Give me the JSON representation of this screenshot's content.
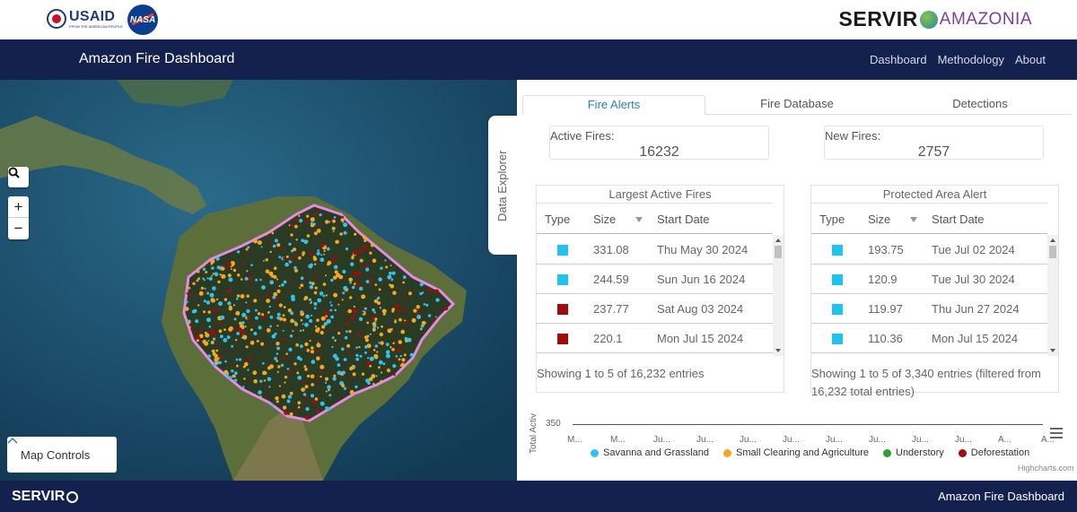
{
  "header": {
    "usaid_label": "USAID",
    "usaid_tagline": "FROM THE AMERICAN PEOPLE",
    "nasa_label": "NASA",
    "servir_label": "SERVIR",
    "amazonia_label": "AMAZONIA"
  },
  "navbar": {
    "title": "Amazon Fire Dashboard",
    "links": [
      "Dashboard",
      "Methodology",
      "About"
    ]
  },
  "map": {
    "search_icon": "search-icon",
    "zoom_in": "+",
    "zoom_out": "−",
    "map_controls_label": "Map Controls",
    "explorer_label": "Data Explorer"
  },
  "tabs": [
    "Fire Alerts",
    "Fire Database",
    "Detections"
  ],
  "active_tab": "Fire Alerts",
  "stats": {
    "active_fires_label": "Active Fires:",
    "active_fires_value": "16232",
    "new_fires_label": "New Fires:",
    "new_fires_value": "2757"
  },
  "largest_fires": {
    "title": "Largest Active Fires",
    "columns": [
      "Type",
      "Size",
      "Start Date"
    ],
    "rows": [
      {
        "color": "#1ec4f0",
        "size": "331.08",
        "date": "Thu May 30 2024"
      },
      {
        "color": "#1ec4f0",
        "size": "244.59",
        "date": "Sun Jun 16 2024"
      },
      {
        "color": "#a30b0b",
        "size": "237.77",
        "date": "Sat Aug 03 2024"
      },
      {
        "color": "#a30b0b",
        "size": "220.1",
        "date": "Mon Jul 15 2024"
      }
    ],
    "info": "Showing 1 to 5 of 16,232 entries"
  },
  "protected_alert": {
    "title": "Protected Area Alert",
    "columns": [
      "Type",
      "Size",
      "Start Date"
    ],
    "rows": [
      {
        "color": "#1ec4f0",
        "size": "193.75",
        "date": "Tue Jul 02 2024"
      },
      {
        "color": "#1ec4f0",
        "size": "120.9",
        "date": "Tue Jul 30 2024"
      },
      {
        "color": "#1ec4f0",
        "size": "119.97",
        "date": "Thu Jun 27 2024"
      },
      {
        "color": "#1ec4f0",
        "size": "110.36",
        "date": "Mon Jul 15 2024"
      }
    ],
    "info": "Showing 1 to 5 of 3,340 entries (filtered from 16,232 total entries)"
  },
  "chart_data": {
    "type": "line",
    "ylabel": "Total Activ",
    "ytick_label": "350",
    "categories": [
      "M...",
      "M...",
      "Ju...",
      "Ju...",
      "Ju...",
      "Ju...",
      "Ju...",
      "Ju...",
      "Ju...",
      "Ju...",
      "A...",
      "A..."
    ],
    "series": [
      {
        "name": "Savanna and Grassland",
        "color": "#2ec3f0"
      },
      {
        "name": "Small Clearing and Agriculture",
        "color": "#f5a623"
      },
      {
        "name": "Understory",
        "color": "#2ca02c"
      },
      {
        "name": "Deforestation",
        "color": "#a30b0b"
      }
    ],
    "credits": "Highcharts.com"
  },
  "footer": {
    "logo": "SERVIR",
    "title": "Amazon Fire Dashboard"
  }
}
